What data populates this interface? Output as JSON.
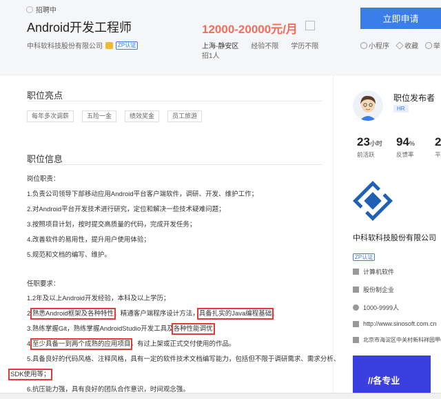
{
  "header": {
    "status": "招聘中",
    "job_title": "Android开发工程师",
    "salary": "12000-20000元/月",
    "company": "中科软科技股份有限公司",
    "verify_badge": "ZP认证",
    "location": "上海-静安区",
    "experience": "经验不限",
    "education": "学历不限",
    "headcount": "招1人",
    "apply_label": "立即申请",
    "actions": [
      "小程序",
      "收藏",
      "举"
    ]
  },
  "highlights": {
    "title": "职位亮点",
    "tags": [
      "每年多次调薪",
      "五险一金",
      "绩效奖金",
      "员工旅游"
    ]
  },
  "job_info": {
    "title": "职位信息",
    "duties_title": "岗位职责：",
    "duties": [
      "1.负责公司领导下部移动应用Android平台客户端软件，调研、开发、维护工作；",
      "2.对Android平台开发技术进行研究，定位和解决一些技术疑难问题；",
      "3.按照项目计划，按时提交高质量的代码，完成开发任务；",
      "4.改善软件的易用性，提升用户使用体验；",
      "5.规范和文档的编写、维护。"
    ],
    "req_title": "任职要求：",
    "req1": "1.2年及以上Android开发经验，本科及以上学历；",
    "req2": [
      "2.",
      "熟悉Android框架及各种特性",
      "，精通客户端程序设计方法，",
      "具备扎实的Java编程基础",
      "；"
    ],
    "req3": [
      "3.熟练掌握Git，熟练掌握AndroidStudio开发工具及",
      "各种性能调优",
      "；"
    ],
    "req4": [
      "4.",
      "至少具备一到两个成熟的应用项目",
      "，有过上架或正式交付使用的作品。"
    ],
    "req5": "5.具备良好的代码风格、注释风格，具有一定的软件技术文档编写能力，包括但不限于调研需求、需求分析、",
    "req5_cont": "SDK使用等；",
    "req6": "6.抗压能力强，具有良好的团队合作意识，时间观念强。"
  },
  "recruiter": {
    "title": "职位发布者",
    "badge": "HR",
    "stats": [
      {
        "num": "23",
        "unit": "小时",
        "label": "前活跃"
      },
      {
        "num": "94",
        "unit": "%",
        "label": "反馈率"
      },
      {
        "num": "2",
        "unit": "",
        "label": "平"
      }
    ]
  },
  "company_card": {
    "name": "中科软科技股份有限公司",
    "badge": "ZP认证",
    "industry": "计算机软件",
    "type": "股份制企业",
    "size": "1000-9999人",
    "website": "http://www.sinosoft.com.cn",
    "address": "北京市海淀区中关村新科祥园甲6",
    "banner_text": "//各专业"
  },
  "colors": {
    "accent": "#3b7de9",
    "salary": "#f26d5b",
    "highlight": "#e53935"
  }
}
